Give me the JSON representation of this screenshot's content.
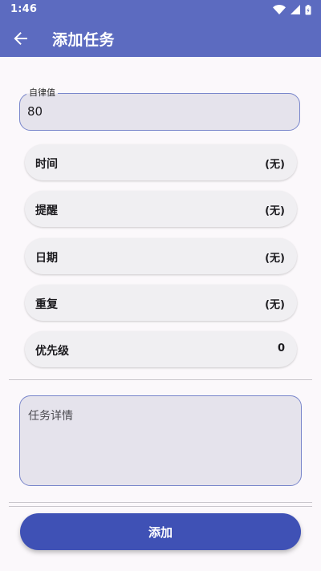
{
  "status_bar": {
    "time": "1:46"
  },
  "app_bar": {
    "title": "添加任务",
    "back_icon": "arrow-back-icon"
  },
  "discipline_field": {
    "label": "自律值",
    "value": "80"
  },
  "settings": [
    {
      "label": "时间",
      "value": "(无)"
    },
    {
      "label": "提醒",
      "value": "(无)"
    },
    {
      "label": "日期",
      "value": "(无)"
    },
    {
      "label": "重复",
      "value": "(无)"
    },
    {
      "label": "优先级",
      "value": "0"
    }
  ],
  "detail_field": {
    "placeholder": "任务详情"
  },
  "add_button": {
    "label": "添加"
  },
  "colors": {
    "primary": "#5c6bc0",
    "button": "#3f51b5",
    "field_fill": "#e5e3ec",
    "outline": "#7986cb"
  }
}
